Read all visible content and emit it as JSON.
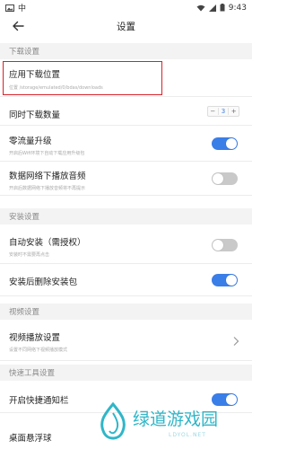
{
  "status_bar": {
    "left_icons": [
      "photo-icon",
      "notification-icon"
    ],
    "left_glyph": "中",
    "right_icons": [
      "wifi-icon",
      "signal-icon",
      "battery-icon"
    ],
    "time": "9:43"
  },
  "header": {
    "title": "设置"
  },
  "sections": {
    "download": "下载设置",
    "install": "安装设置",
    "video": "视频设置",
    "tools": "快速工具设置"
  },
  "rows": {
    "download_location": {
      "label": "应用下载位置",
      "sub": "位置 /storage/emulated/0/bdas/downloads"
    },
    "concurrent_downloads": {
      "label": "同时下载数量",
      "minus": "−",
      "value": "3",
      "plus": "+"
    },
    "zero_traffic": {
      "label": "零流量升级",
      "sub": "开启后Wifi环境下自动下载应用升级包",
      "toggle": "on"
    },
    "data_audio": {
      "label": "数据网络下播放音频",
      "sub": "开启后数据网络下播放音频将不再提示",
      "toggle": "off"
    },
    "auto_install": {
      "label": "自动安装（需授权）",
      "sub": "安装时不需要再点击",
      "toggle": "off"
    },
    "delete_after_install": {
      "label": "安装后删除安装包",
      "toggle": "on"
    },
    "video_playback": {
      "label": "视频播放设置",
      "sub": "设置不同网络下视频播放模式"
    },
    "quick_notification": {
      "label": "开启快捷通知栏",
      "toggle": "on"
    },
    "floating_ball": {
      "label": "桌面悬浮球"
    }
  },
  "watermark": {
    "text": "绿道游戏园",
    "sub": "LDYOL.NET"
  },
  "colors": {
    "accent": "#3a7ee8",
    "highlight": "#d8212a",
    "watermark": "#2fb6c8"
  }
}
